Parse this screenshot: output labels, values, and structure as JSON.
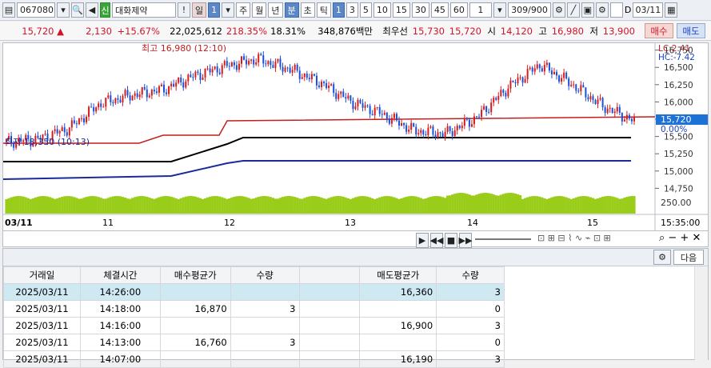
{
  "toolbar": {
    "code": "067080",
    "market_tag": "신",
    "stock_name": "대화제약",
    "alert": "!",
    "period_day": "일",
    "period_num": "1",
    "periods": [
      "주",
      "월",
      "년",
      "분",
      "초",
      "틱"
    ],
    "minute_buttons": [
      "1",
      "3",
      "5",
      "10",
      "15",
      "30",
      "45",
      "60"
    ],
    "interval": "1",
    "count": "309/900",
    "checkbox_label": "D",
    "date": "03/11"
  },
  "quote": {
    "price": "15,720",
    "change": "2,130",
    "change_pct": "+15.67%",
    "volume": "22,025,612",
    "vol_ratio": "218.35%",
    "turnover": "18.31%",
    "amount": "348,876백만",
    "best_label": "최우선",
    "ask": "15,730",
    "bid": "15,720",
    "open_label": "시",
    "open": "14,120",
    "high_label": "고",
    "high": "16,980",
    "low_label": "저",
    "low": "13,900",
    "buy_label": "매수",
    "sell_label": "매도"
  },
  "chart": {
    "high_note": "최고 16,980 (12:10)",
    "low_note": "최저 13,350 (10:13)",
    "lc": "LC:2.41",
    "hc": "HC:-7.42",
    "current_price": "15,720",
    "current_pct": "0.00%",
    "price_ticks": [
      "16,750",
      "16,500",
      "16,250",
      "16,000",
      "15,750",
      "15,500",
      "15,250",
      "15,000",
      "14,750"
    ],
    "volume_tick": "250.00",
    "date_labels": [
      "03/11",
      "11",
      "12",
      "13",
      "14",
      "15"
    ],
    "time_label": "15:35:00"
  },
  "chart_data": {
    "type": "line",
    "title": "",
    "ylim": [
      14650,
      16850
    ],
    "series": [
      {
        "x": [
          0,
          5,
          10,
          15,
          20,
          25,
          30,
          35,
          40,
          45,
          50,
          55,
          60,
          65,
          70,
          75,
          80,
          85,
          90,
          95,
          100
        ],
        "values": [
          15420,
          15460,
          15620,
          15980,
          16100,
          16180,
          16380,
          16520,
          16620,
          16480,
          16280,
          16000,
          15820,
          15580,
          15540,
          15780,
          16220,
          16540,
          16260,
          15940,
          15720
        ]
      }
    ]
  },
  "table": {
    "headers": [
      "거래일",
      "체결시간",
      "매수평균가",
      "수량",
      "",
      "매도평균가",
      "수량"
    ],
    "rows": [
      [
        "2025/03/11",
        "14:26:00",
        "",
        "",
        "",
        "16,360",
        "3"
      ],
      [
        "2025/03/11",
        "14:18:00",
        "16,870",
        "3",
        "",
        "",
        "0"
      ],
      [
        "2025/03/11",
        "14:16:00",
        "",
        "",
        "",
        "16,900",
        "3"
      ],
      [
        "2025/03/11",
        "14:13:00",
        "16,760",
        "3",
        "",
        "",
        "0"
      ],
      [
        "2025/03/11",
        "14:07:00",
        "",
        "",
        "",
        "16,190",
        "3"
      ]
    ]
  },
  "next_label": "다음"
}
